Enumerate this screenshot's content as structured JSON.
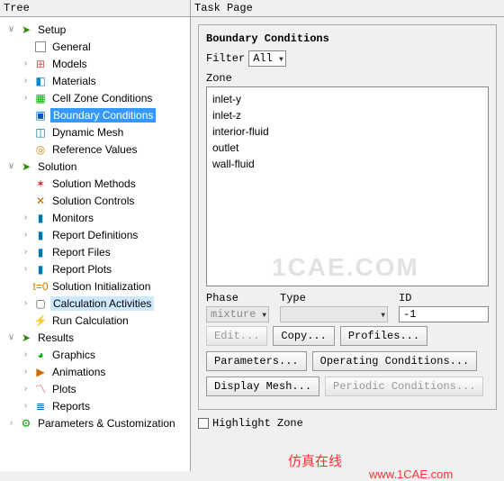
{
  "panes": {
    "tree_title": "Tree",
    "task_title": "Task Page"
  },
  "tree": {
    "setup": "Setup",
    "general": "General",
    "models": "Models",
    "materials": "Materials",
    "cell_zone": "Cell Zone Conditions",
    "boundary": "Boundary Conditions",
    "dyn_mesh": "Dynamic Mesh",
    "ref_values": "Reference Values",
    "solution": "Solution",
    "sol_methods": "Solution Methods",
    "sol_controls": "Solution Controls",
    "monitors": "Monitors",
    "rep_def": "Report Definitions",
    "rep_files": "Report Files",
    "rep_plots": "Report Plots",
    "sol_init": "Solution Initialization",
    "calc_act": "Calculation Activities",
    "run_calc": "Run Calculation",
    "results": "Results",
    "graphics": "Graphics",
    "animations": "Animations",
    "plots": "Plots",
    "reports": "Reports",
    "params": "Parameters & Customization"
  },
  "bc": {
    "title": "Boundary Conditions",
    "filter_label": "Filter",
    "filter_value": "All",
    "zone_label": "Zone",
    "zones": [
      "inlet-y",
      "inlet-z",
      "interior-fluid",
      "outlet",
      "wall-fluid"
    ],
    "phase_label": "Phase",
    "phase_value": "mixture",
    "type_label": "Type",
    "type_value": "",
    "id_label": "ID",
    "id_value": "-1",
    "buttons": {
      "edit": "Edit...",
      "copy": "Copy...",
      "profiles": "Profiles...",
      "parameters": "Parameters...",
      "op_cond": "Operating Conditions...",
      "disp_mesh": "Display Mesh...",
      "periodic": "Periodic Conditions..."
    },
    "highlight": "Highlight Zone"
  },
  "watermarks": {
    "big": "1CAE.COM",
    "cn": "仿真在线",
    "url": "www.1CAE.com"
  }
}
